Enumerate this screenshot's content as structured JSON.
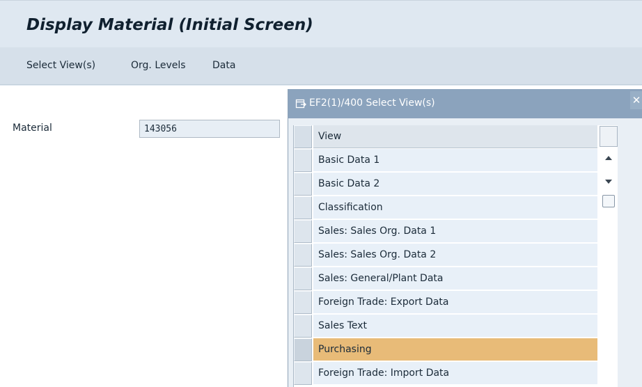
{
  "header": {
    "title": "Display Material (Initial Screen)"
  },
  "menu": {
    "items": [
      {
        "label": "Select View(s)"
      },
      {
        "label": "Org. Levels"
      },
      {
        "label": "Data"
      }
    ]
  },
  "form": {
    "material_label": "Material",
    "material_value": "143056"
  },
  "dialog": {
    "title": "EF2(1)/400 Select View(s)",
    "icon": "dialog-window-icon",
    "close_label": "✕",
    "column_header": "View",
    "views": [
      {
        "label": "Basic Data 1",
        "highlighted": false
      },
      {
        "label": "Basic Data 2",
        "highlighted": false
      },
      {
        "label": "Classification",
        "highlighted": false
      },
      {
        "label": "Sales: Sales Org. Data 1",
        "highlighted": false
      },
      {
        "label": "Sales: Sales Org. Data 2",
        "highlighted": false
      },
      {
        "label": "Sales: General/Plant Data",
        "highlighted": false
      },
      {
        "label": "Foreign Trade: Export Data",
        "highlighted": false
      },
      {
        "label": "Sales Text",
        "highlighted": false
      },
      {
        "label": "Purchasing",
        "highlighted": true
      },
      {
        "label": "Foreign Trade: Import Data",
        "highlighted": false
      }
    ]
  },
  "colors": {
    "highlight": "#e8bb78",
    "titlebar": "#8ba3bd",
    "header_bg": "#dfe8f1"
  }
}
